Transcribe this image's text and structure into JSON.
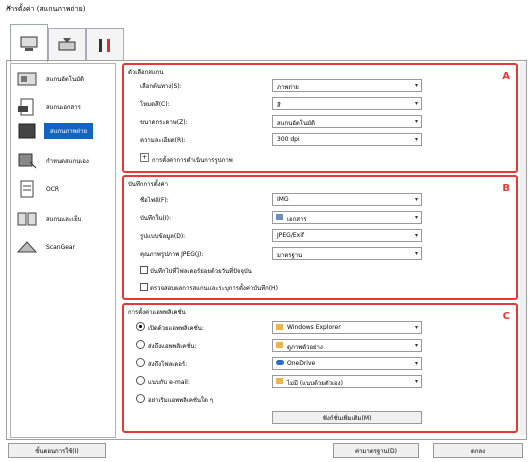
{
  "window": {
    "title": "การตั้งค่า (สแกนภาพถ่าย)",
    "close": "✕"
  },
  "sidebar": {
    "items": [
      {
        "label": "สแกนอัตโนมัติ",
        "icon": "auto-scan-icon"
      },
      {
        "label": "สแกนเอกสาร",
        "icon": "document-scan-icon"
      },
      {
        "label": "สแกนภาพถ่าย",
        "icon": "photo-scan-icon",
        "selected": true
      },
      {
        "label": "กำหนดสแกนเอง",
        "icon": "custom-scan-icon"
      },
      {
        "label": "OCR",
        "icon": "ocr-icon"
      },
      {
        "label": "สแกนและเย็บ",
        "icon": "stitch-icon"
      },
      {
        "label": "ScanGear",
        "icon": "scangear-icon"
      }
    ]
  },
  "scan_options": {
    "header": "ตัวเลือกสแกน",
    "letter": "A",
    "rows": [
      {
        "label": "เลือกต้นทาง(S):",
        "value": "ภาพถ่าย"
      },
      {
        "label": "โหมดสี(C):",
        "value": "สี"
      },
      {
        "label": "ขนาดกระดาษ(Z):",
        "value": "สแกนอัตโนมัติ"
      },
      {
        "label": "ความละเอียด(R):",
        "value": "300 dpi"
      }
    ],
    "image_processing": "การตั้งค่าการดำเนินการรูปภาพ"
  },
  "save_settings": {
    "header": "บันทึกการตั้งค่า",
    "letter": "B",
    "rows": [
      {
        "label": "ชื่อไฟล์(F):",
        "value": "IMG"
      },
      {
        "label": "บันทึกใน(I):",
        "value": "เอกสาร"
      },
      {
        "label": "รูปแบบข้อมูล(D):",
        "value": "JPEG/Exif"
      },
      {
        "label": "คุณภาพรูปภาพ JPEG(J):",
        "value": "มาตรฐาน"
      }
    ],
    "check1": "บันทึกไปที่โฟลเดอร์ย่อยด้วยวันที่ปัจจุบัน",
    "check2": "ตรวจสอบผลการสแกนและระบุการตั้งค่าบันทึก(H)"
  },
  "app_settings": {
    "header": "การตั้งค่าแอพพลิเคชั่น",
    "letter": "C",
    "rows": [
      {
        "label": "เปิดด้วยแอพพลิเคชั่น:",
        "value": "Windows Explorer",
        "selected": true
      },
      {
        "label": "ส่งถึงแอพพลิเคชั่น:",
        "value": "ดูภาพตัวอย่าง"
      },
      {
        "label": "ส่งถึงโฟลเดอร์:",
        "value": "OneDrive"
      },
      {
        "label": "แนบกับ e-mail:",
        "value": "ไม่มี (แนบด้วยตัวเอง)"
      },
      {
        "label": "อย่าเริ่มแอพพลิเคชั่นใด ๆ",
        "value": ""
      }
    ],
    "more_functions": "ฟังก์ชั่นเพิ่มเติม(M)"
  },
  "footer": {
    "instructions": "ขั้นตอนการใช้(I)",
    "defaults": "ค่ามาตรฐาน(D)",
    "ok": "ตกลง"
  }
}
